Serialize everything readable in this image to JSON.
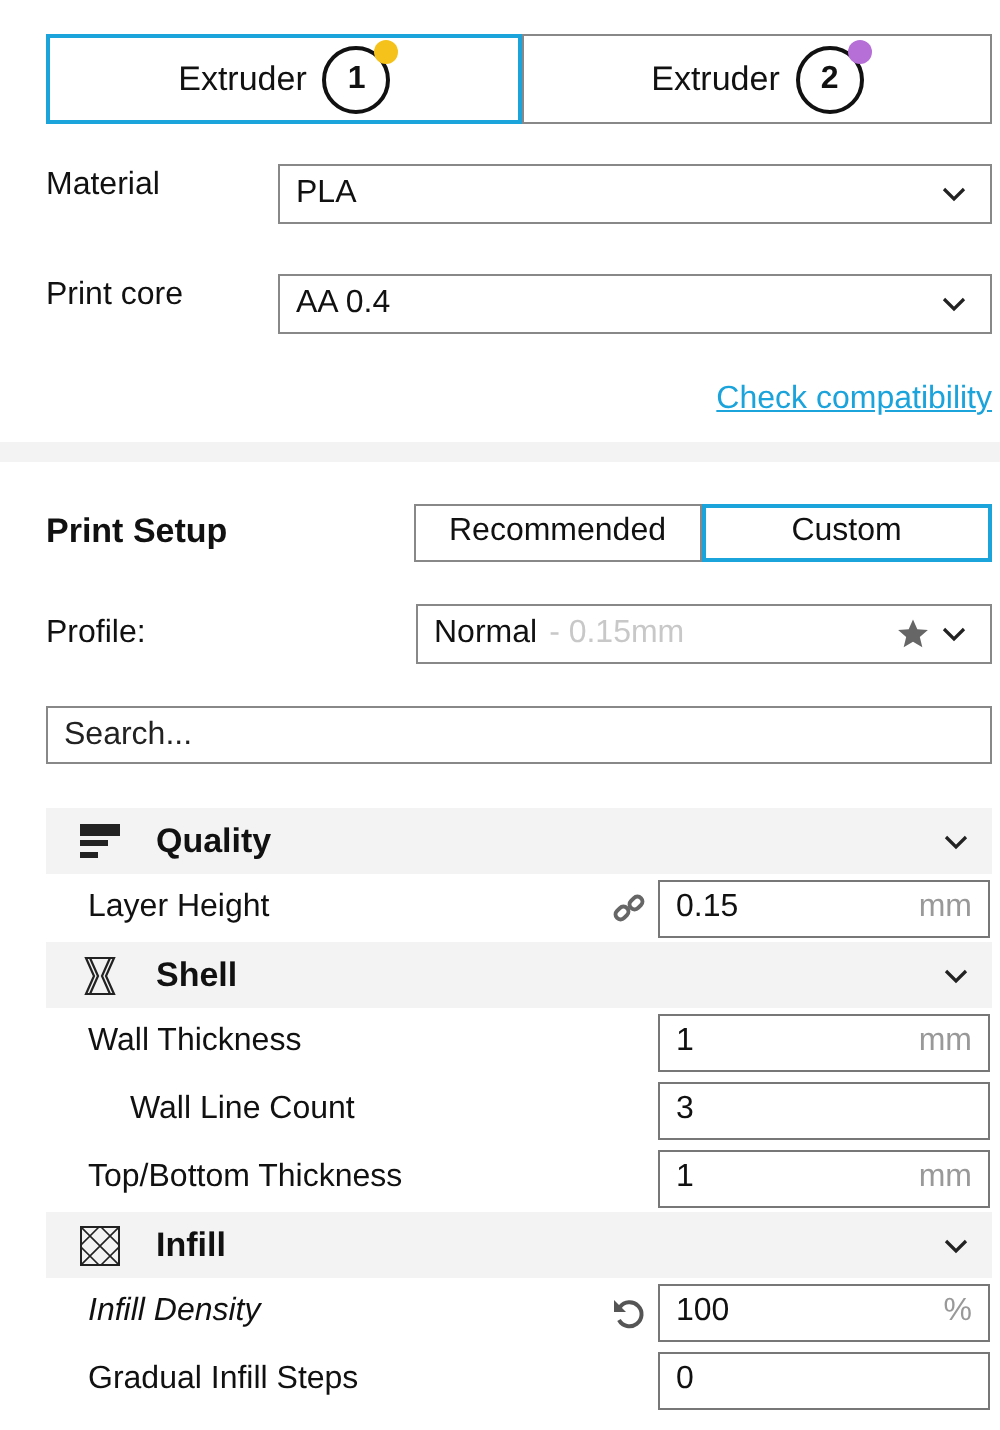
{
  "extruders": [
    {
      "label": "Extruder",
      "number": "1",
      "selected": true,
      "color": "#f5c21b"
    },
    {
      "label": "Extruder",
      "number": "2",
      "selected": false,
      "color": "#b56fd6"
    }
  ],
  "material": {
    "label": "Material",
    "value": "PLA"
  },
  "print_core": {
    "label": "Print core",
    "value": "AA 0.4"
  },
  "check_link": "Check compatibility",
  "print_setup": {
    "title": "Print Setup",
    "modes": [
      {
        "label": "Recommended",
        "selected": false
      },
      {
        "label": "Custom",
        "selected": true
      }
    ],
    "profile": {
      "label": "Profile:",
      "name": "Normal",
      "detail": "- 0.15mm"
    },
    "search": {
      "placeholder": "Search..."
    }
  },
  "categories": [
    {
      "kind": "quality",
      "title": "Quality",
      "expanded": true,
      "settings": [
        {
          "label": "Layer Height",
          "value": "0.15",
          "unit": "mm",
          "linked": true,
          "overridden": false
        }
      ]
    },
    {
      "kind": "shell",
      "title": "Shell",
      "expanded": true,
      "settings": [
        {
          "label": "Wall Thickness",
          "value": "1",
          "unit": "mm",
          "linked": false,
          "overridden": false,
          "children": [
            {
              "label": "Wall Line Count",
              "value": "3",
              "linked": false,
              "overridden": false
            }
          ]
        },
        {
          "label": "Top/Bottom Thickness",
          "value": "1",
          "unit": "mm",
          "linked": false,
          "overridden": false
        }
      ]
    },
    {
      "kind": "infill",
      "title": "Infill",
      "expanded": true,
      "settings": [
        {
          "label": "Infill Density",
          "value": "100",
          "unit": "%",
          "linked": false,
          "overridden": true
        },
        {
          "label": "Gradual Infill Steps",
          "value": "0",
          "linked": false,
          "overridden": false
        }
      ]
    }
  ]
}
